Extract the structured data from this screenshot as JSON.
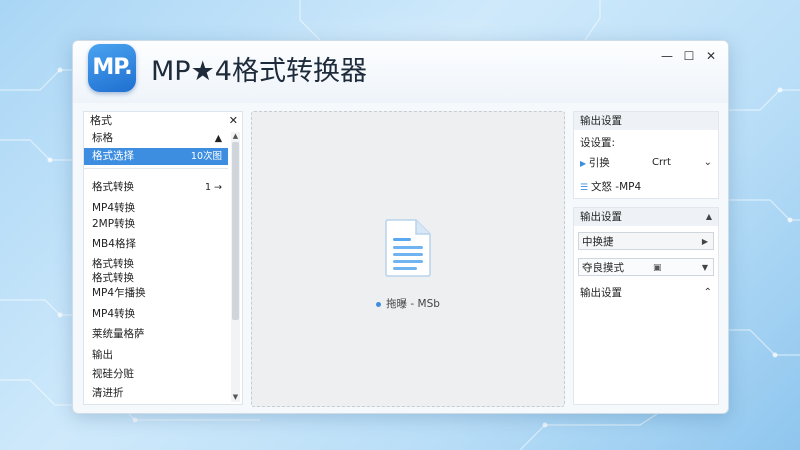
{
  "app": {
    "logo_text": "MP.",
    "title": "MP★4格式转换器"
  },
  "window_controls": {
    "minimize": "—",
    "maximize": "☐",
    "close": "✕"
  },
  "left_panel": {
    "header": "格式",
    "close": "✕",
    "items": [
      {
        "label": "标格",
        "right": "▲"
      },
      {
        "label": "格式选择",
        "right": "10次图",
        "selected": true
      },
      {
        "label": "格式转换",
        "right": "1 →"
      },
      {
        "label": "MP4转换",
        "right": ""
      },
      {
        "label": "2MP转换",
        "right": ""
      },
      {
        "label": "MB4格择",
        "right": ""
      },
      {
        "label": "格式转换",
        "right": ""
      },
      {
        "label": "格式转换",
        "right": ""
      },
      {
        "label": "MP4乍播换",
        "right": ""
      },
      {
        "label": "MP4转换",
        "right": ""
      },
      {
        "label": "莱统量格萨",
        "right": ""
      },
      {
        "label": "输出",
        "right": ""
      },
      {
        "label": "视硅分赃",
        "right": ""
      },
      {
        "label": "清进折",
        "right": ""
      }
    ]
  },
  "dropzone": {
    "caption": "拖曝 - MSb"
  },
  "right_panel": {
    "section1": {
      "header": "输出设置",
      "row1": "设设置:",
      "row2_label": "引换",
      "row2_value": "Crrt",
      "row3_label": "文怒 -MP4"
    },
    "section2": {
      "header": "输出设置",
      "field1": "中换捷",
      "field2_label": "夺良摸式",
      "row_bottom": "输出设置"
    }
  }
}
